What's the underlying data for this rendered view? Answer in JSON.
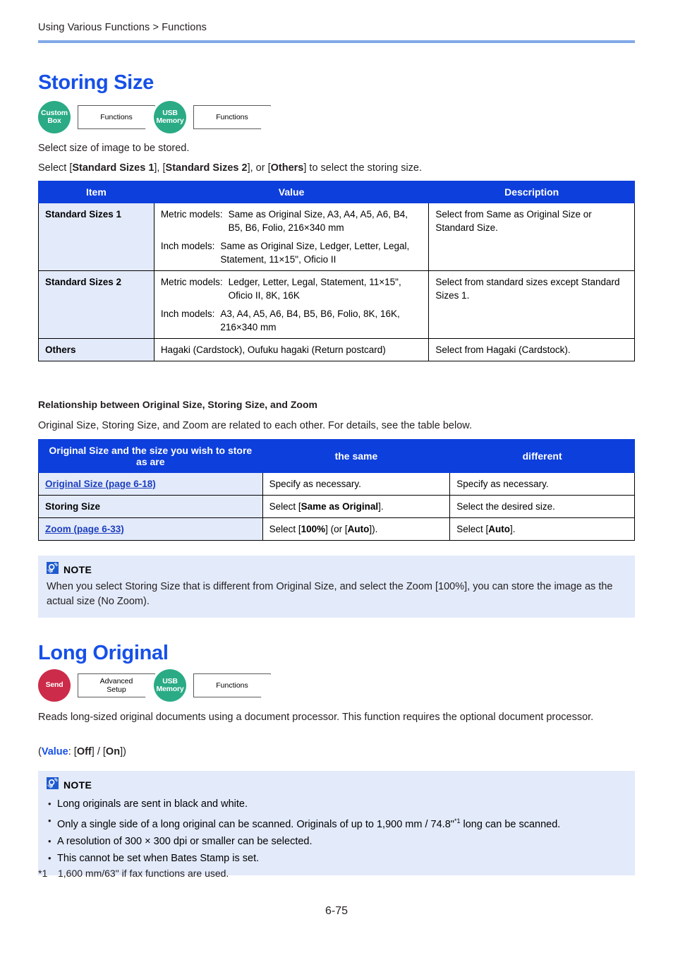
{
  "breadcrumb": "Using Various Functions > Functions",
  "colors": {
    "heading_blue": "#1650e8",
    "table_header_blue": "#0d3fdc",
    "row_tint": "#e3eafa",
    "rule_blue": "#82a9e8",
    "badge_green": "#2aab85",
    "badge_red": "#cc2b49",
    "link_blue": "#1c3fbf"
  },
  "sections": {
    "storing_size": {
      "title": "Storing Size",
      "badges": [
        {
          "circle": "Custom Box",
          "circle_line1": "Custom",
          "circle_line2": "Box",
          "color": "green",
          "tag": "Functions",
          "tag_line1": "Functions",
          "tag_line2": ""
        },
        {
          "circle": "USB Memory",
          "circle_line1": "USB",
          "circle_line2": "Memory",
          "color": "green",
          "tag": "Functions",
          "tag_line1": "Functions",
          "tag_line2": ""
        }
      ],
      "intro1": "Select size of image to be stored.",
      "intro2_parts": [
        "Select [",
        "Standard Sizes 1",
        "], [",
        "Standard Sizes 2",
        "], or [",
        "Others",
        "] to select the storing size."
      ],
      "table": {
        "headers": [
          "Item",
          "Value",
          "Description"
        ],
        "rows": [
          {
            "item": "Standard Sizes 1",
            "value_groups": [
              {
                "label": "Metric models:",
                "text": "Same as Original Size, A3, A4, A5, A6, B4, B5, B6, Folio, 216×340 mm"
              },
              {
                "label": "Inch models:",
                "text": "Same as Original Size, Ledger, Letter, Legal, Statement, 11×15\", Oficio II"
              }
            ],
            "description": "Select from Same as Original Size or Standard Size."
          },
          {
            "item": "Standard Sizes 2",
            "value_groups": [
              {
                "label": "Metric models:",
                "text": "Ledger, Letter, Legal, Statement, 11×15\", Oficio II, 8K, 16K"
              },
              {
                "label": "Inch models:",
                "text": "A3, A4, A5, A6, B4, B5, B6, Folio, 8K, 16K, 216×340 mm"
              }
            ],
            "description": "Select from standard sizes except Standard Sizes 1."
          },
          {
            "item": "Others",
            "value_groups": [
              {
                "label": "",
                "text": "Hagaki (Cardstock), Oufuku hagaki (Return postcard)"
              }
            ],
            "description": "Select from Hagaki (Cardstock)."
          }
        ]
      },
      "relationship_heading": "Relationship between Original Size, Storing Size, and Zoom",
      "relationship_intro": "Original Size, Storing Size, and Zoom are related to each other. For details, see the table below.",
      "relationship_table": {
        "headers": [
          "Original Size and the size you wish to store as are",
          "the same",
          "different"
        ],
        "rows": [
          {
            "label": "Original Size (page 6-18)",
            "label_is_link": true,
            "same_parts": [
              "Specify as necessary.",
              "",
              ""
            ],
            "same": "Specify as necessary.",
            "different": "Specify as necessary."
          },
          {
            "label": "Storing Size",
            "label_is_link": false,
            "same_pre": "Select [",
            "same_bold": "Same as Original",
            "same_post": "].",
            "same": "Select [Same as Original].",
            "different": "Select the desired size."
          },
          {
            "label": "Zoom (page 6-33)",
            "label_is_link": true,
            "same_pre": "Select [",
            "same_bold": "100%",
            "same_mid": "] (or [",
            "same_bold2": "Auto",
            "same_post": "]).",
            "same": "Select [100%] (or [Auto]).",
            "different_pre": "Select [",
            "different_bold": "Auto",
            "different_post": "].",
            "different": "Select [Auto]."
          }
        ]
      },
      "note": {
        "title": "NOTE",
        "icon": "note-lightbulb-icon",
        "body": "When you select Storing Size that is different from Original Size, and select the Zoom [100%], you can store the image as the actual size (No Zoom)."
      }
    },
    "long_original": {
      "title": "Long Original",
      "badges": [
        {
          "circle": "Send",
          "circle_line1": "Send",
          "circle_line2": "",
          "color": "red",
          "tag": "Advanced Setup",
          "tag_line1": "Advanced",
          "tag_line2": "Setup"
        },
        {
          "circle": "USB Memory",
          "circle_line1": "USB",
          "circle_line2": "Memory",
          "color": "green",
          "tag": "Functions",
          "tag_line1": "Functions",
          "tag_line2": ""
        }
      ],
      "body": "Reads long-sized original documents using a document processor. This function requires the optional document processor.",
      "value_line": {
        "open": "(",
        "label": "Value",
        "sep": ": [",
        "v1": "Off",
        "mid": "] / [",
        "v2": "On",
        "close": "])"
      },
      "note": {
        "title": "NOTE",
        "icon": "note-lightbulb-icon",
        "items": [
          {
            "text": "Long originals are sent in black and white."
          },
          {
            "pre": "Only a single side of a long original can be scanned. Originals of up to 1,900 mm / 74.8\"",
            "sup": "*1",
            "post": " long can be scanned."
          },
          {
            "text": "A resolution of 300  ×  300  dpi or smaller can be selected."
          },
          {
            "text": "This cannot be set when Bates Stamp is set."
          }
        ]
      }
    }
  },
  "footnote": {
    "mark": "*1",
    "text": "1,600 mm/63\" if fax functions are used."
  },
  "page_number": "6-75"
}
